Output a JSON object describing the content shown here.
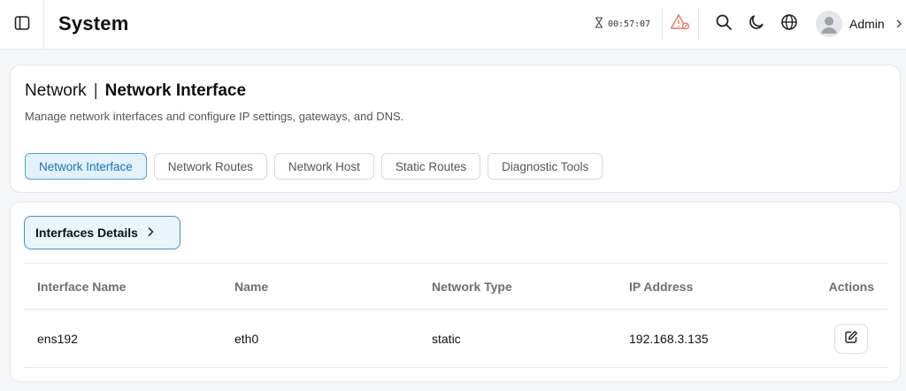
{
  "header": {
    "title": "System",
    "timer": "00:57:07",
    "user_name": "Admin",
    "alert_color": "#e8755a"
  },
  "page": {
    "breadcrumb_parent": "Network",
    "breadcrumb_separator": "|",
    "breadcrumb_current": "Network Interface",
    "subtitle": "Manage network interfaces and configure IP settings, gateways, and DNS."
  },
  "tabs": [
    {
      "label": "Network Interface",
      "active": true
    },
    {
      "label": "Network Routes",
      "active": false
    },
    {
      "label": "Network Host",
      "active": false
    },
    {
      "label": "Static Routes",
      "active": false
    },
    {
      "label": "Diagnostic Tools",
      "active": false
    }
  ],
  "details": {
    "button_label": "Interfaces Details"
  },
  "table": {
    "columns": [
      "Interface Name",
      "Name",
      "Network Type",
      "IP Address",
      "Actions"
    ],
    "rows": [
      {
        "interface_name": "ens192",
        "name": "eth0",
        "network_type": "static",
        "ip_address": "192.168.3.135"
      }
    ]
  },
  "colors": {
    "accent": "#3d93d1",
    "accent_bg": "#e9f4fc"
  }
}
